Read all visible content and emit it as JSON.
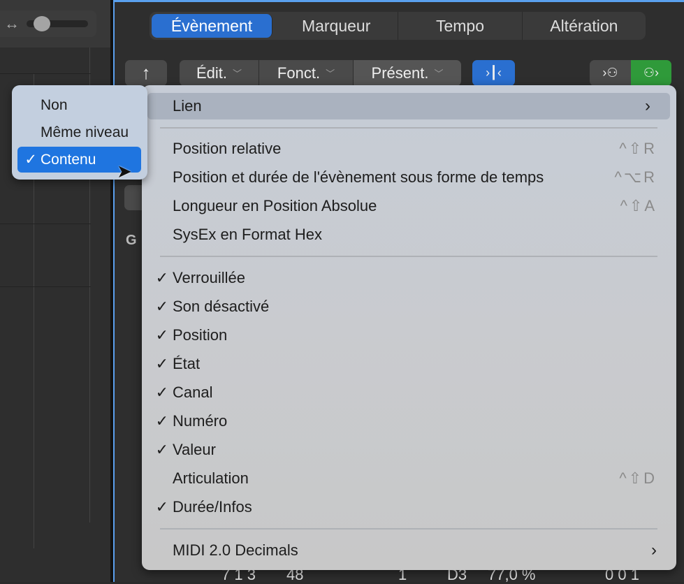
{
  "left": {
    "width_icon": "horizontal-arrows-icon",
    "zoom_slider_value": 0.2
  },
  "tabs": [
    {
      "label": "Évènement",
      "active": true
    },
    {
      "label": "Marqueur"
    },
    {
      "label": "Tempo"
    },
    {
      "label": "Altération"
    }
  ],
  "toolbar": {
    "up_icon": "arrow-up-hook-icon",
    "edit": "Édit.",
    "functions": "Fonct.",
    "view": "Présent.",
    "catch_icon": "catch-playhead-icon",
    "midi_in_icon": "midi-in-icon",
    "midi_out_icon": "midi-out-icon",
    "accent": "#2a6fd0",
    "green": "#2f9a3a"
  },
  "behind": {
    "g_label": "G",
    "row": [
      "7 1 3",
      "48",
      "1",
      "D3",
      "77,0 %",
      "0 0 1"
    ]
  },
  "menu": {
    "link": "Lien",
    "group1": [
      {
        "label": "Position relative",
        "shortcut": "^⇧R"
      },
      {
        "label": "Position et durée de l'évènement sous forme de temps",
        "shortcut": "^⌥R"
      },
      {
        "label": "Longueur en Position Absolue",
        "shortcut": "^⇧A"
      },
      {
        "label": "SysEx en Format Hex",
        "shortcut": ""
      }
    ],
    "group2": [
      {
        "label": "Verrouillée",
        "checked": "✓",
        "shortcut": ""
      },
      {
        "label": "Son désactivé",
        "checked": "✓",
        "shortcut": ""
      },
      {
        "label": "Position",
        "checked": "✓",
        "shortcut": ""
      },
      {
        "label": "État",
        "checked": "✓",
        "shortcut": ""
      },
      {
        "label": "Canal",
        "checked": "✓",
        "shortcut": ""
      },
      {
        "label": "Numéro",
        "checked": "✓",
        "shortcut": ""
      },
      {
        "label": "Valeur",
        "checked": "✓",
        "shortcut": ""
      },
      {
        "label": "Articulation",
        "checked": "",
        "shortcut": "^⇧D"
      },
      {
        "label": "Durée/Infos",
        "checked": "✓",
        "shortcut": ""
      }
    ],
    "midi2": "MIDI 2.0 Decimals"
  },
  "submenu": [
    {
      "label": "Non",
      "checked": ""
    },
    {
      "label": "Même niveau",
      "checked": ""
    },
    {
      "label": "Contenu",
      "checked": "✓",
      "selected": true
    }
  ]
}
